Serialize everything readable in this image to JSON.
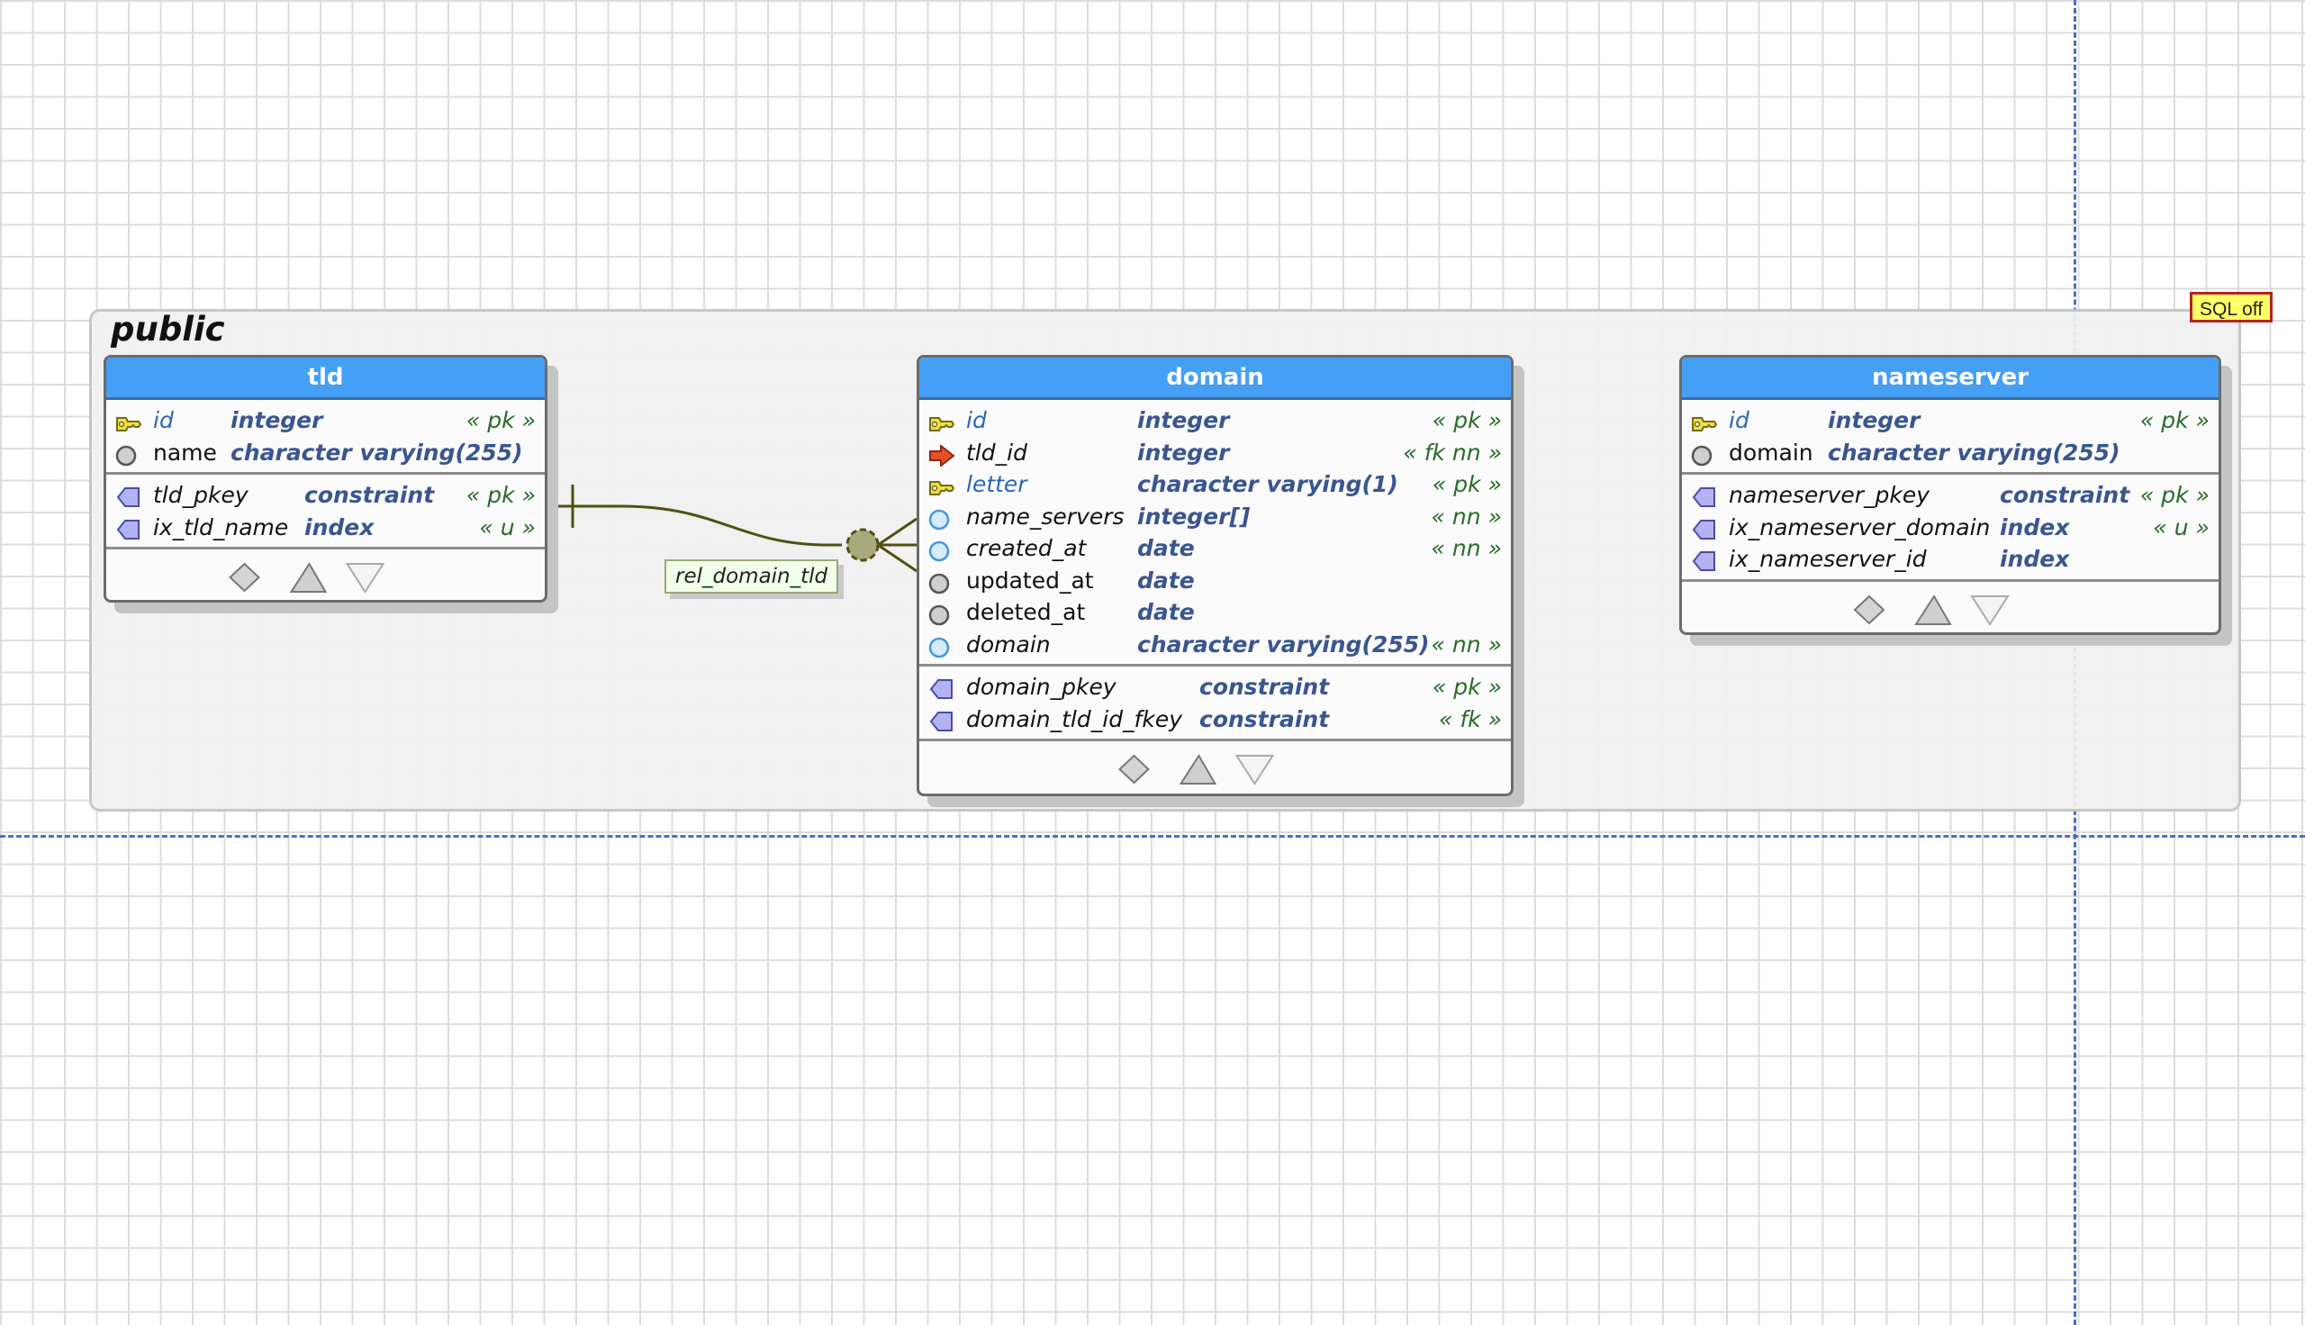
{
  "schema": {
    "name": "public"
  },
  "badge": {
    "label": "SQL off"
  },
  "relationship": {
    "name": "rel_domain_tld"
  },
  "tables": [
    {
      "name": "tld",
      "columns": [
        {
          "name": "id",
          "type": "integer",
          "flags": "« pk »",
          "icon": "key-icon"
        },
        {
          "name": "name",
          "type": "character varying(255)",
          "flags": "",
          "icon": "gray-circle-icon"
        }
      ],
      "constraints": [
        {
          "name": "tld_pkey",
          "type": "constraint",
          "flags": "« pk »",
          "icon": "constraint-icon"
        },
        {
          "name": "ix_tld_name",
          "type": "index",
          "flags": "« u »",
          "icon": "index-icon"
        }
      ]
    },
    {
      "name": "domain",
      "columns": [
        {
          "name": "id",
          "type": "integer",
          "flags": "« pk »",
          "icon": "key-icon"
        },
        {
          "name": "tld_id",
          "type": "integer",
          "flags": "« fk nn »",
          "icon": "foreign-key-arrow-icon"
        },
        {
          "name": "letter",
          "type": "character varying(1)",
          "flags": "« pk »",
          "icon": "key-icon"
        },
        {
          "name": "name_servers",
          "type": "integer[]",
          "flags": "« nn »",
          "icon": "blue-circle-icon"
        },
        {
          "name": "created_at",
          "type": "date",
          "flags": "« nn »",
          "icon": "blue-circle-icon"
        },
        {
          "name": "updated_at",
          "type": "date",
          "flags": "",
          "icon": "gray-circle-icon"
        },
        {
          "name": "deleted_at",
          "type": "date",
          "flags": "",
          "icon": "gray-circle-icon"
        },
        {
          "name": "domain",
          "type": "character varying(255)",
          "flags": "« nn »",
          "icon": "blue-circle-icon"
        }
      ],
      "constraints": [
        {
          "name": "domain_pkey",
          "type": "constraint",
          "flags": "« pk »",
          "icon": "constraint-icon"
        },
        {
          "name": "domain_tld_id_fkey",
          "type": "constraint",
          "flags": "« fk »",
          "icon": "constraint-icon"
        }
      ]
    },
    {
      "name": "nameserver",
      "columns": [
        {
          "name": "id",
          "type": "integer",
          "flags": "« pk »",
          "icon": "key-icon"
        },
        {
          "name": "domain",
          "type": "character varying(255)",
          "flags": "",
          "icon": "gray-circle-icon"
        }
      ],
      "constraints": [
        {
          "name": "nameserver_pkey",
          "type": "constraint",
          "flags": "« pk »",
          "icon": "constraint-icon"
        },
        {
          "name": "ix_nameserver_domain",
          "type": "index",
          "flags": "« u »",
          "icon": "index-icon"
        },
        {
          "name": "ix_nameserver_id",
          "type": "index",
          "flags": "",
          "icon": "index-icon"
        }
      ]
    }
  ],
  "colors": {
    "header": "#45a0f5",
    "key": "#f2e234",
    "foreign_key": "#e4502c",
    "relation_line": "#4f4f12",
    "constraint": "#b3b3f2",
    "type_text": "#3a5590",
    "flag_text": "#2c6a2c"
  }
}
